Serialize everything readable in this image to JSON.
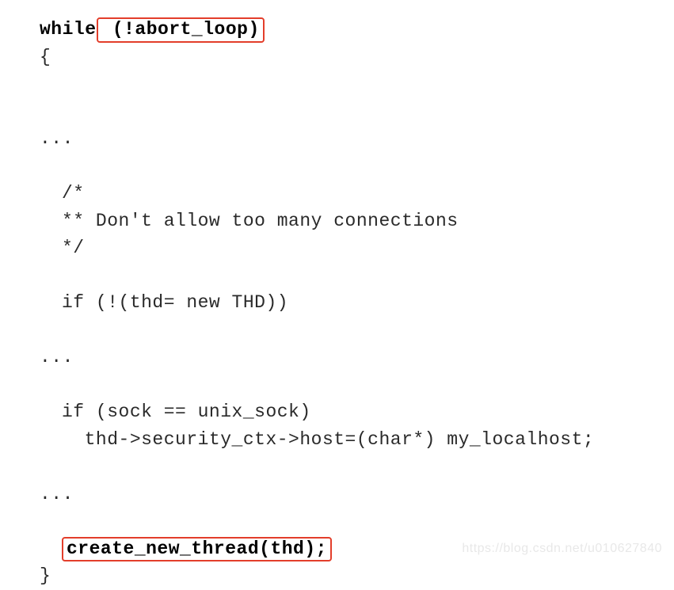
{
  "code": {
    "l1_while": "while",
    "l1_cond": " (!abort_loop)",
    "l2": "{",
    "l3": "...",
    "l4": "/*",
    "l5": "** Don't allow too many connections",
    "l6": "*/",
    "l7": "if (!(thd= new THD))",
    "l8": "...",
    "l9": "if (sock == unix_sock)",
    "l10": "  thd->security_ctx->host=(char*) my_localhost;",
    "l11": "...",
    "l12": "create_new_thread(thd);",
    "l13": "}"
  },
  "watermark": "https://blog.csdn.net/u010627840"
}
